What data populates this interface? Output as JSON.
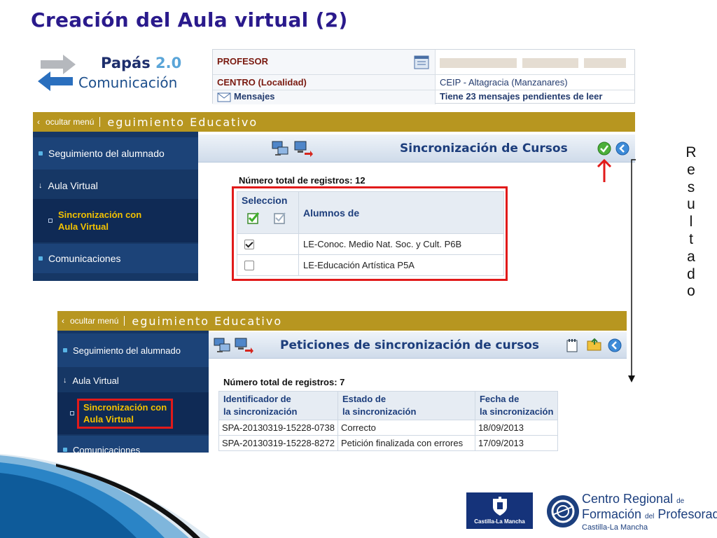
{
  "slide": {
    "title": "Creación del Aula virtual (2)"
  },
  "logo": {
    "papas": "Papás",
    "version": "2.0",
    "subtitle": "Comunicación"
  },
  "info": {
    "profesor_label": "PROFESOR",
    "centro_label": "CENTRO (Localidad)",
    "centro_value": "CEIP - Altagracia (Manzanares)",
    "mensajes_label": "Mensajes",
    "mensajes_value": "Tiene 23 mensajes pendientes de leer"
  },
  "app1": {
    "hide_menu": "ocultar menú",
    "section_title": "eguimiento Educativo",
    "sidebar": {
      "seguimiento": "Seguimiento del alumnado",
      "aula_virtual": "Aula Virtual",
      "sincronizacion": "Sincronización con",
      "sincronizacion2": "Aula Virtual",
      "comunicaciones": "Comunicaciones"
    },
    "toolbar_title": "Sincronización de Cursos",
    "total": "Número total de registros: 12",
    "table": {
      "col_seleccion": "Seleccion",
      "col_alumnos": "Alumnos de",
      "rows": [
        {
          "checked": true,
          "name": "LE-Conoc. Medio Nat. Soc. y Cult. P6B"
        },
        {
          "checked": false,
          "name": "LE-Educación Artística P5A"
        }
      ]
    }
  },
  "app2": {
    "hide_menu": "ocultar menú",
    "section_title": "eguimiento Educativo",
    "sidebar": {
      "seguimiento": "Seguimiento del alumnado",
      "aula_virtual": "Aula Virtual",
      "sincronizacion": "Sincronización con",
      "sincronizacion2": "Aula Virtual",
      "comunicaciones": "Comunicaciones"
    },
    "toolbar_title": "Peticiones de sincronización de cursos",
    "total": "Número total de registros: 7",
    "table": {
      "headers": [
        [
          "Identificador de",
          "la sincronización"
        ],
        [
          "Estado de",
          "la sincronización"
        ],
        [
          "Fecha de",
          "la sincronización"
        ]
      ],
      "rows": [
        [
          "SPA-20130319-15228-0738",
          "Correcto",
          "18/09/2013"
        ],
        [
          "SPA-20130319-15228-8272",
          "Petición finalizada con errores",
          "17/09/2013"
        ]
      ]
    }
  },
  "annotation": {
    "resultado_letters": [
      "R",
      "e",
      "s",
      "u",
      "l",
      "t",
      "a",
      "d",
      "o"
    ]
  },
  "footer": {
    "jccm": "Castilla-La Mancha",
    "crfp_line1": "Centro Regional",
    "crfp_de": "de",
    "crfp_line2a": "Formación",
    "crfp_del": "del",
    "crfp_line2b": "Profesorado",
    "crfp_line3": "Castilla-La Mancha"
  },
  "colors": {
    "title": "#2a1a8c",
    "gold_bar": "#b79620",
    "sidebar": "#163765",
    "highlight": "#f2c100",
    "annotation_red": "#e11a1a"
  }
}
